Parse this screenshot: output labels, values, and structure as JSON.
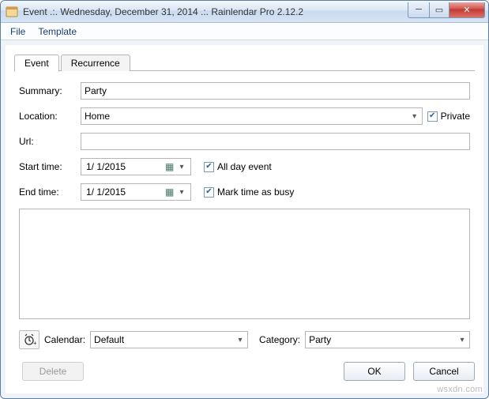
{
  "window": {
    "title": "Event .:. Wednesday, December 31, 2014 .:. Rainlendar Pro 2.12.2"
  },
  "menu": {
    "file": "File",
    "template": "Template"
  },
  "tabs": {
    "event": "Event",
    "recurrence": "Recurrence"
  },
  "labels": {
    "summary": "Summary:",
    "location": "Location:",
    "url": "Url:",
    "start_time": "Start time:",
    "end_time": "End time:",
    "private": "Private",
    "all_day": "All day event",
    "busy": "Mark time as busy",
    "calendar": "Calendar:",
    "category": "Category:"
  },
  "values": {
    "summary": "Party",
    "location": "Home",
    "url": "",
    "start_date": "1/  1/2015",
    "end_date": "1/  1/2015",
    "calendar": "Default",
    "category": "Party",
    "notes": ""
  },
  "buttons": {
    "delete": "Delete",
    "ok": "OK",
    "cancel": "Cancel"
  },
  "watermark": "wsxdn.com"
}
